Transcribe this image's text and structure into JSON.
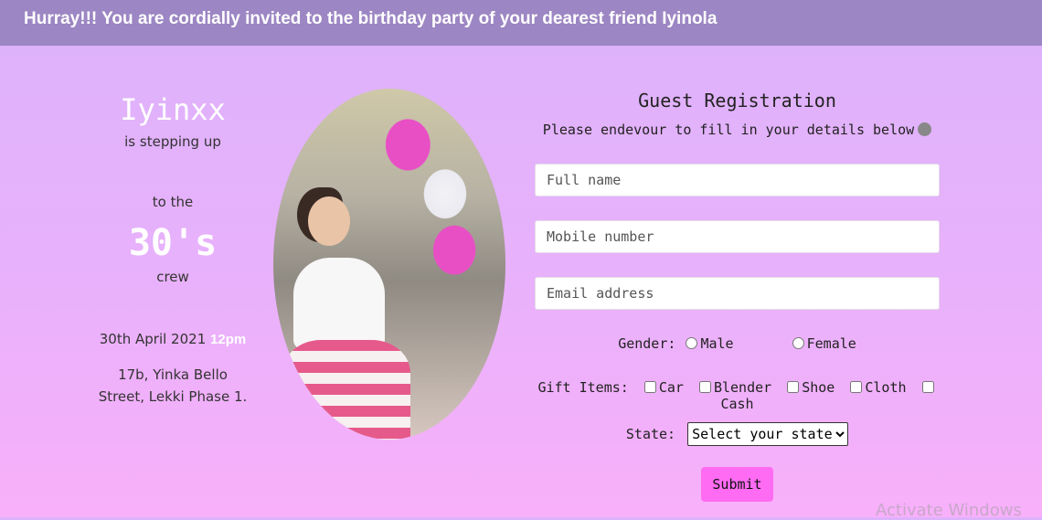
{
  "banner": {
    "text": "Hurray!!! You are cordially invited to the birthday party of your dearest friend Iyinola"
  },
  "invite": {
    "name": "Iyinxx",
    "stepping": "is stepping up",
    "to_the": "to the",
    "age": "30's",
    "crew": "crew",
    "date": "30th April 2021",
    "time": "12pm",
    "address_line1": "17b, Yinka Bello",
    "address_line2": "Street, Lekki Phase 1."
  },
  "form": {
    "title": "Guest Registration",
    "subtitle": "Please endevour to fill in your details below",
    "full_name_placeholder": "Full name",
    "mobile_placeholder": "Mobile number",
    "email_placeholder": "Email address",
    "gender_label": "Gender:",
    "gender_options": [
      "Male",
      "Female"
    ],
    "gift_label": "Gift Items:",
    "gift_options": [
      "Car",
      "Blender",
      "Shoe",
      "Cloth",
      "Cash"
    ],
    "state_label": "State:",
    "state_selected": "Select your state",
    "submit_label": "Submit"
  },
  "system": {
    "watermark": "Activate Windows"
  },
  "colors": {
    "banner": "#9c86c3",
    "submit": "#ff6bf2",
    "accent_text": "#ffffff"
  }
}
